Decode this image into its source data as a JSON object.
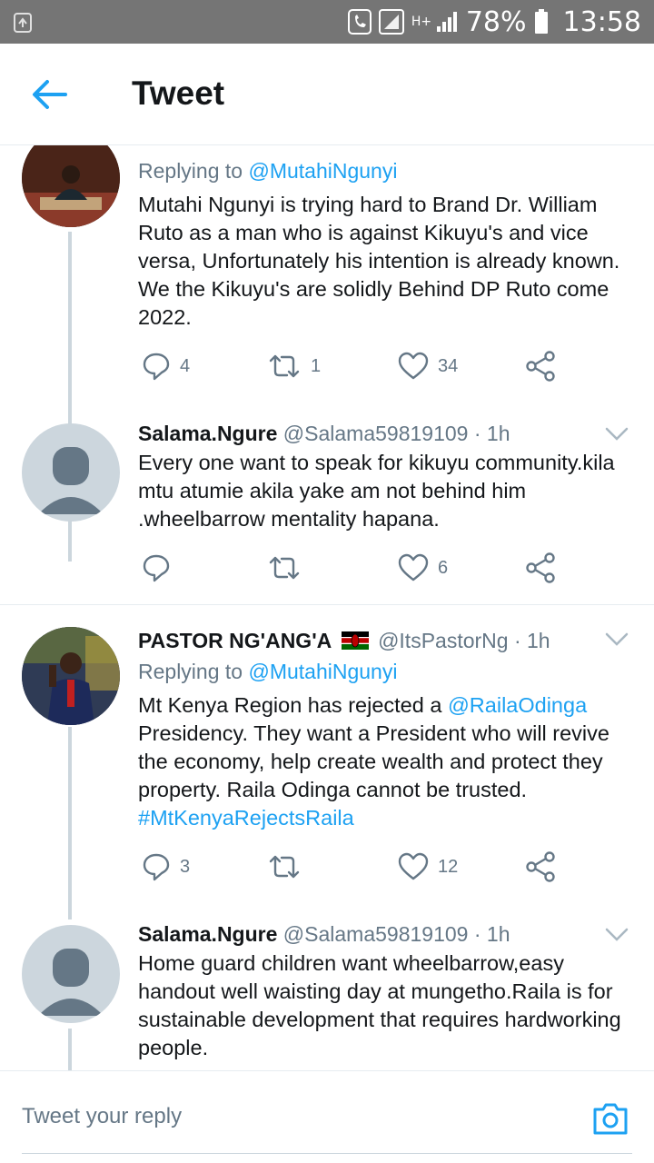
{
  "status_bar": {
    "battery": "78%",
    "time": "13:58",
    "network": "H+"
  },
  "header": {
    "title": "Tweet"
  },
  "colors": {
    "accent": "#1da1f2",
    "text_secondary": "#657786",
    "line": "#ccd6dd"
  },
  "tweets": [
    {
      "name": "",
      "handle": "",
      "time": "",
      "reply_prefix": "Replying to ",
      "reply_to": "@MutahiNgunyi",
      "text": "Mutahi Ngunyi is trying hard to Brand Dr. William Ruto as a man who is against Kikuyu's and vice versa, Unfortunately his intention is already known. We the Kikuyu's are solidly Behind DP Ruto come 2022.",
      "replies": "4",
      "retweets": "1",
      "likes": "34"
    },
    {
      "name": "Salama.Ngure",
      "handle": "@Salama59819109",
      "time": "· 1h",
      "text": "Every one want to speak for kikuyu community.kila mtu atumie akila yake am not behind him .wheelbarrow mentality hapana.",
      "replies": "",
      "retweets": "",
      "likes": "6"
    },
    {
      "name": "PASTOR NG'ANG'A",
      "handle": "@ItsPastorNg",
      "time": "· 1h",
      "reply_prefix": "Replying to ",
      "reply_to": "@MutahiNgunyi",
      "text_before": "Mt Kenya Region has rejected a ",
      "mention": "@RailaOdinga",
      "text_after": " Presidency. They want a President who will revive the economy, help create wealth and protect they property. Raila Odinga cannot be trusted.",
      "hashtag": "#MtKenyaRejectsRaila",
      "replies": "3",
      "retweets": "",
      "likes": "12"
    },
    {
      "name": "Salama.Ngure",
      "handle": "@Salama59819109",
      "time": "· 1h",
      "text": "Home guard children want wheelbarrow,easy handout well waisting day at mungetho.Raila is for sustainable development that requires hardworking people."
    }
  ],
  "reply_bar": {
    "placeholder": "Tweet your reply"
  }
}
